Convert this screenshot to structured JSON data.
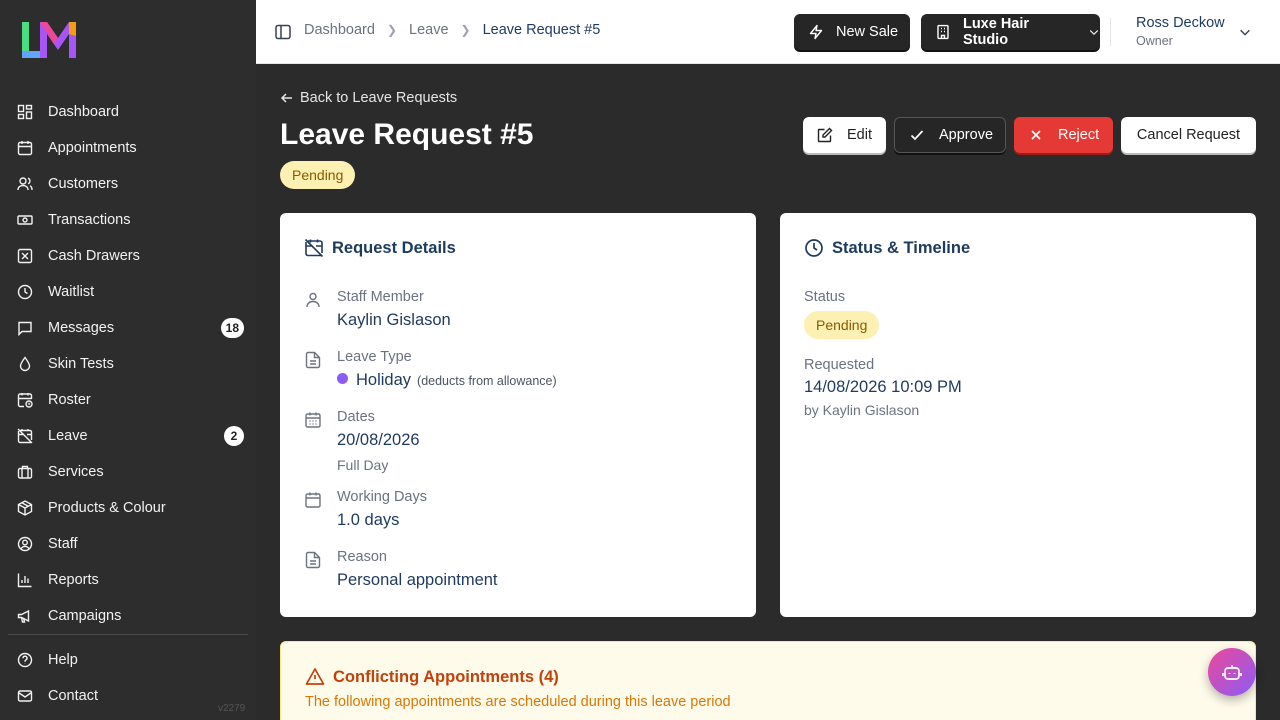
{
  "brand": {
    "logo_text": "LM"
  },
  "sidebar": {
    "items": [
      {
        "label": "Dashboard",
        "icon": "dashboard-icon"
      },
      {
        "label": "Appointments",
        "icon": "calendar-icon"
      },
      {
        "label": "Customers",
        "icon": "users-icon"
      },
      {
        "label": "Transactions",
        "icon": "banknote-icon"
      },
      {
        "label": "Cash Drawers",
        "icon": "box-x-icon"
      },
      {
        "label": "Waitlist",
        "icon": "clock-icon"
      },
      {
        "label": "Messages",
        "icon": "message-icon",
        "badge": "18"
      },
      {
        "label": "Skin Tests",
        "icon": "droplet-icon"
      },
      {
        "label": "Roster",
        "icon": "calendar-clock-icon"
      },
      {
        "label": "Leave",
        "icon": "calendar-off-icon",
        "badge": "2"
      },
      {
        "label": "Services",
        "icon": "briefcase-icon"
      },
      {
        "label": "Products & Colour",
        "icon": "package-icon"
      },
      {
        "label": "Staff",
        "icon": "user-circle-icon"
      },
      {
        "label": "Reports",
        "icon": "bar-chart-icon"
      },
      {
        "label": "Campaigns",
        "icon": "megaphone-icon"
      }
    ],
    "bottom": [
      {
        "label": "Help",
        "icon": "help-circle-icon"
      },
      {
        "label": "Contact",
        "icon": "mail-icon"
      }
    ],
    "version": "v2279"
  },
  "topbar": {
    "breadcrumbs": [
      "Dashboard",
      "Leave",
      "Leave Request #5"
    ],
    "new_sale_label": "New Sale",
    "studio_label": "Luxe Hair Studio",
    "user_name": "Ross Deckow",
    "user_role": "Owner"
  },
  "page": {
    "back_label": "Back to Leave Requests",
    "title": "Leave Request #5",
    "status": "Pending",
    "actions": {
      "edit": "Edit",
      "approve": "Approve",
      "reject": "Reject",
      "cancel": "Cancel Request"
    }
  },
  "request_details": {
    "title": "Request Details",
    "staff_label": "Staff Member",
    "staff_value": "Kaylin Gislason",
    "type_label": "Leave Type",
    "type_value": "Holiday",
    "type_note": "(deducts from allowance)",
    "type_color": "#8b5cf6",
    "dates_label": "Dates",
    "dates_value": "20/08/2026",
    "dates_sub": "Full Day",
    "working_label": "Working Days",
    "working_value": "1.0 days",
    "reason_label": "Reason",
    "reason_value": "Personal appointment"
  },
  "status_timeline": {
    "title": "Status & Timeline",
    "status_label": "Status",
    "status_value": "Pending",
    "requested_label": "Requested",
    "requested_value": "14/08/2026 10:09 PM",
    "requested_by": "by Kaylin Gislason"
  },
  "conflicts": {
    "title": "Conflicting Appointments (4)",
    "subtitle": "The following appointments are scheduled during this leave period"
  },
  "colors": {
    "accent_navy": "#1e3a5f",
    "danger": "#e53935",
    "pending_bg": "#fdf0b3",
    "warning": "#c2410c"
  }
}
